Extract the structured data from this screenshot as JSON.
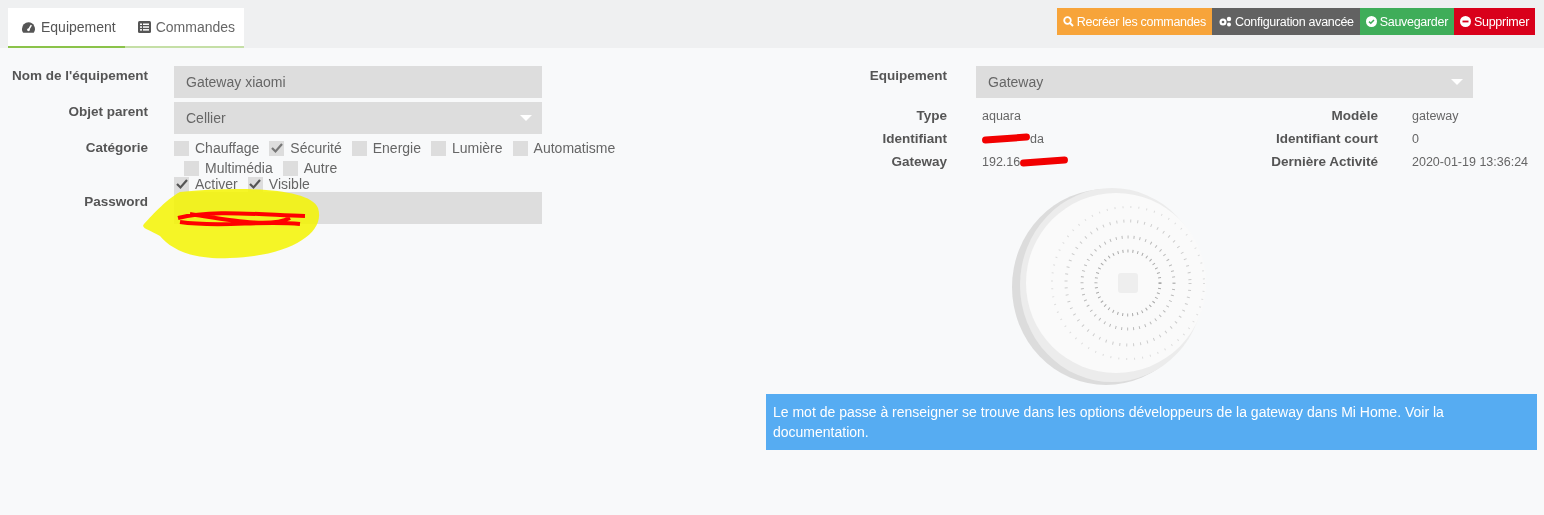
{
  "tabs": [
    {
      "label": "Equipement",
      "selected": true
    },
    {
      "label": "Commandes",
      "selected": false
    }
  ],
  "actions": [
    {
      "label": "Recréer les commandes",
      "kind": "search",
      "color": "#f7a43a"
    },
    {
      "label": "Configuration avancée",
      "kind": "cogs",
      "color": "#626262"
    },
    {
      "label": "Sauvegarder",
      "kind": "check",
      "color": "#3fad59"
    },
    {
      "label": "Supprimer",
      "kind": "minus",
      "color": "#d9001b"
    }
  ],
  "form": {
    "name": {
      "label": "Nom de l'équipement",
      "value": "Gateway xiaomi"
    },
    "parent": {
      "label": "Objet parent",
      "value": "Cellier"
    },
    "category": {
      "label": "Catégorie",
      "options": [
        {
          "label": "Chauffage",
          "checked": false
        },
        {
          "label": "Sécurité",
          "checked": true
        },
        {
          "label": "Energie",
          "checked": false
        },
        {
          "label": "Lumière",
          "checked": false
        },
        {
          "label": "Automatisme",
          "checked": false
        },
        {
          "label": "Multimédia",
          "checked": false
        },
        {
          "label": "Autre",
          "checked": false
        }
      ]
    },
    "flags": [
      {
        "label": "Activer",
        "checked": true
      },
      {
        "label": "Visible",
        "checked": true
      }
    ],
    "password": {
      "label": "Password"
    }
  },
  "device": {
    "label": "Equipement",
    "value": "Gateway",
    "info": [
      {
        "label": "Type",
        "value": "aquara",
        "label2": "Modèle",
        "value2": "gateway"
      },
      {
        "label": "Identifiant",
        "value": "da",
        "redacted": true,
        "label2": "Identifiant court",
        "value2": "0"
      },
      {
        "label": "Gateway",
        "value": "192.16",
        "redacted": true,
        "label2": "Dernière Activité",
        "value2": "2020-01-19 13:36:24"
      }
    ]
  },
  "notice": "Le mot de passe à renseigner se trouve dans les options développeurs de la gateway dans Mi Home. Voir la documentation."
}
